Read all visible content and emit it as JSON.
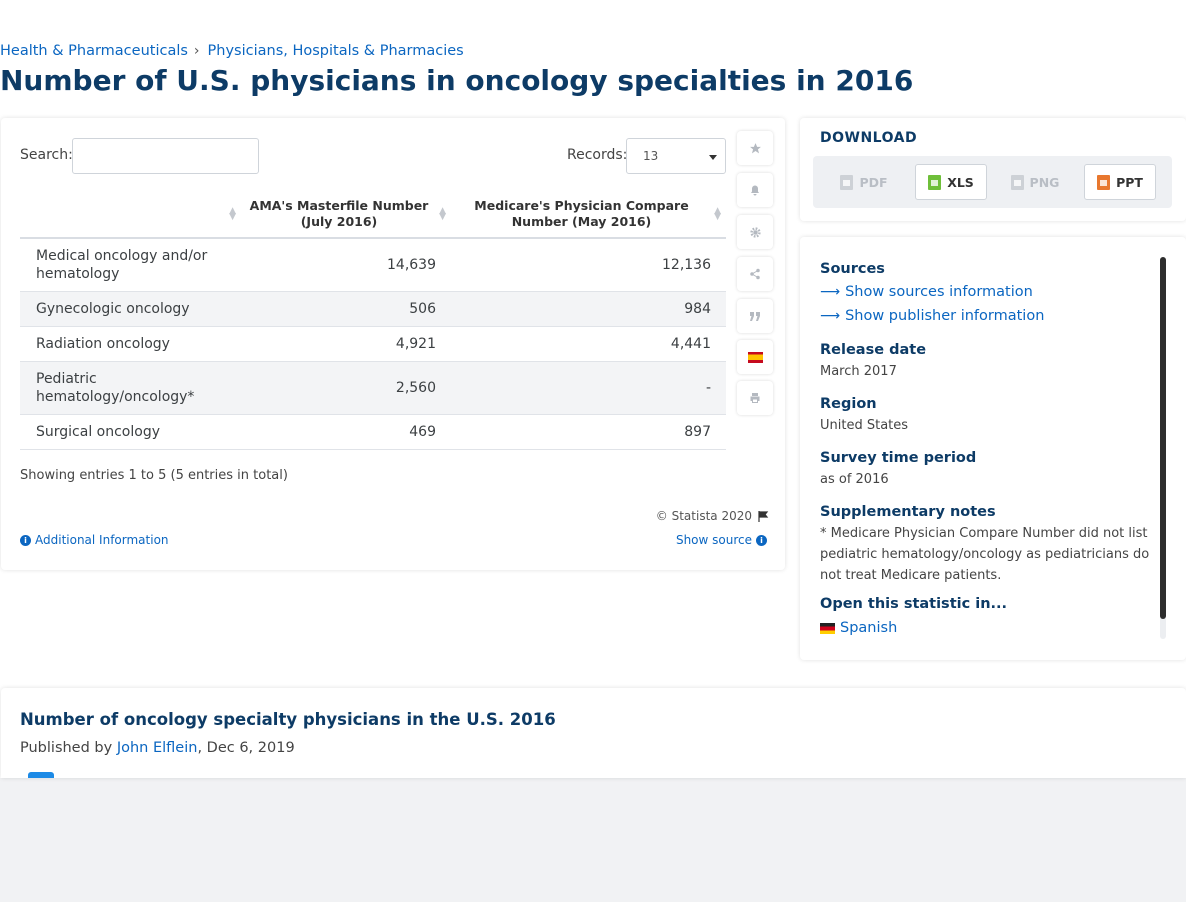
{
  "breadcrumb": [
    "Health & Pharmaceuticals",
    "Physicians, Hospitals & Pharmacies"
  ],
  "breadcrumb_sep": "›",
  "page_title": "Number of U.S. physicians in oncology specialties in 2016",
  "table_controls": {
    "search_label": "Search:",
    "search_value": "",
    "records_label": "Records:",
    "records_value": "13"
  },
  "table": {
    "columns": [
      "",
      "AMA's Masterfile Number (July 2016)",
      "Medicare's Physician Compare Number (May 2016)"
    ],
    "rows": [
      [
        "Medical oncology and/or hematology",
        "14,639",
        "12,136"
      ],
      [
        "Gynecologic oncology",
        "506",
        "984"
      ],
      [
        "Radiation oncology",
        "4,921",
        "4,441"
      ],
      [
        "Pediatric hematology/oncology*",
        "2,560",
        "-"
      ],
      [
        "Surgical oncology",
        "469",
        "897"
      ]
    ],
    "entries_text": "Showing entries 1 to 5 (5 entries in total)"
  },
  "footer": {
    "copyright": "© Statista 2020",
    "additional_info": "Additional Information",
    "show_source": "Show source"
  },
  "toolbar": [
    "star-icon",
    "bell-icon",
    "gear-icon",
    "share-icon",
    "quote-icon",
    "spanish-flag-icon",
    "print-icon"
  ],
  "download": {
    "title": "DOWNLOAD",
    "buttons": [
      {
        "label": "PDF",
        "enabled": false
      },
      {
        "label": "XLS",
        "enabled": true
      },
      {
        "label": "PNG",
        "enabled": false
      },
      {
        "label": "PPT",
        "enabled": true
      }
    ]
  },
  "info": {
    "sources_h": "Sources",
    "show_sources": "Show sources information",
    "show_publisher": "Show publisher information",
    "release_h": "Release date",
    "release_v": "March 2017",
    "region_h": "Region",
    "region_v": "United States",
    "survey_h": "Survey time period",
    "survey_v": "as of 2016",
    "supp_h": "Supplementary notes",
    "supp_v": "* Medicare Physician Compare Number did not list pediatric hematology/oncology as pediatricians do not treat Medicare patients.",
    "open_h": "Open this statistic in...",
    "open_lang": "Spanish"
  },
  "bottom": {
    "title": "Number of oncology specialty physicians in the U.S. 2016",
    "published_by": "Published by",
    "author": "John Elflein",
    "date": ", Dec 6, 2019"
  },
  "colors": {
    "title_navy": "#0d3b66",
    "link_blue": "#0b66c1",
    "xls_green": "#6fbf3a",
    "ppt_orange": "#e8772e"
  }
}
